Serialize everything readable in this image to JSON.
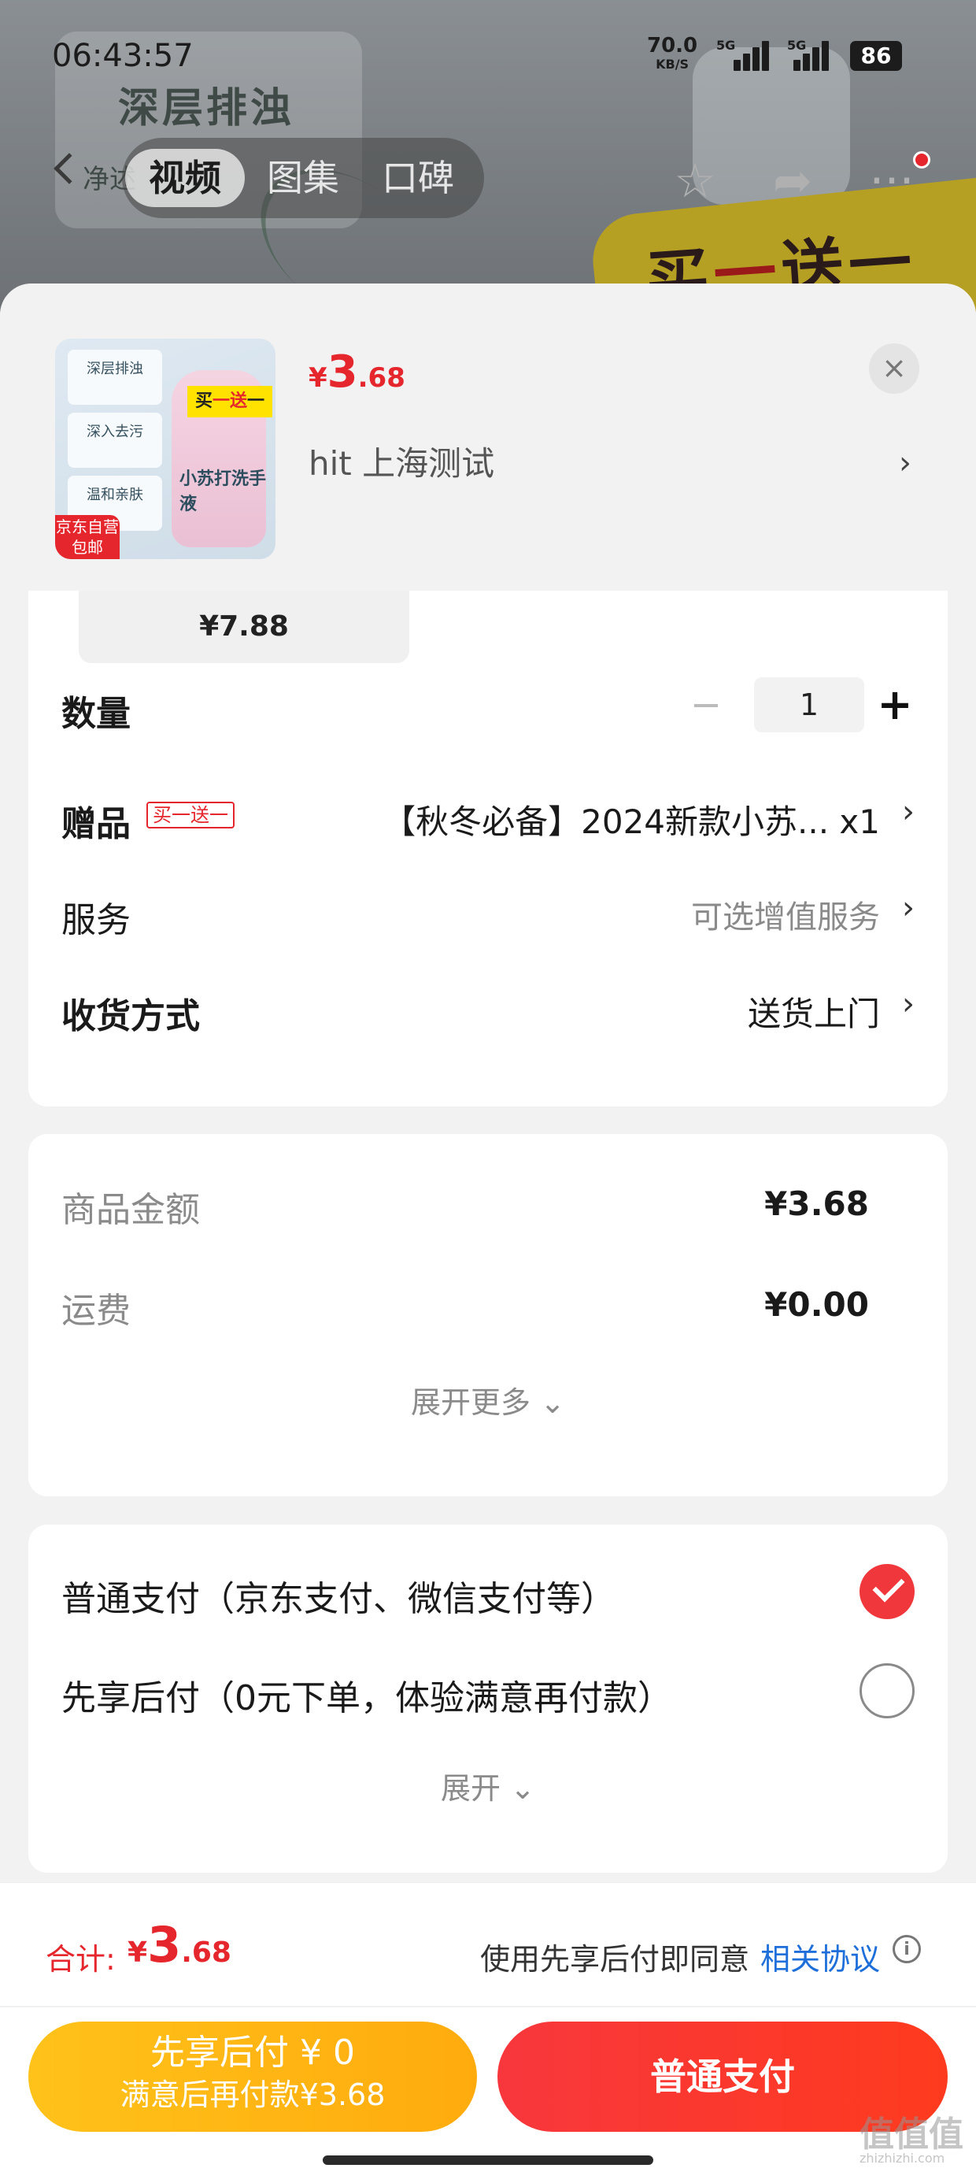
{
  "status_bar": {
    "time": "06:43:57",
    "net_speed": "70.0",
    "net_unit": "KB/S",
    "signal1_label": "5G",
    "signal2_label": "5G",
    "battery": "86"
  },
  "background_page": {
    "banner_title": "深层排浊",
    "banner_sub": "净述",
    "promo_text_a": "买",
    "promo_text_b": "一",
    "promo_text_c": "送一",
    "media_tabs": [
      "视频",
      "图集",
      "口碑"
    ],
    "active_tab_index": 0
  },
  "sheet": {
    "thumb": {
      "card1": "深层排浊",
      "card2": "深入去污",
      "card3": "温和亲肤",
      "promo_a": "买",
      "promo_b": "一送",
      "promo_c": "一",
      "bottle_label": "小苏打洗手液",
      "badge_line1": "京东自营",
      "badge_line2": "包邮"
    },
    "price": {
      "currency": "¥",
      "int": "3",
      "dec": ".68"
    },
    "variant": "hit  上海测试",
    "close_label": "×"
  },
  "card1": {
    "spec_price": "¥7.88",
    "quantity_label": "数量",
    "quantity_value": "1",
    "minus": "−",
    "plus": "+",
    "gift_label": "赠品",
    "gift_tag": "买一送一",
    "gift_value": "【秋冬必备】2024新款小苏... x1",
    "service_label": "服务",
    "service_value": "可选增值服务",
    "delivery_label": "收货方式",
    "delivery_value": "送货上门",
    "arrow": "›"
  },
  "card2": {
    "goods_amount_label": "商品金额",
    "goods_amount_value": "¥3.68",
    "shipping_label": "运费",
    "shipping_value": "¥0.00",
    "expand_more": "展开更多 ⌄"
  },
  "card3": {
    "pay_normal": "普通支付（京东支付、微信支付等）",
    "pay_normal_checked": true,
    "pay_bnpl": "先享后付（0元下单，体验满意再付款）",
    "pay_bnpl_checked": false,
    "expand": "展开 ⌄"
  },
  "bottom": {
    "total_label": "合计:",
    "total": {
      "currency": "¥",
      "int": "3",
      "dec": ".68"
    },
    "agree_text": "使用先享后付即同意",
    "agree_link": "相关协议",
    "info": "i",
    "bnpl_line1": "先享后付 ¥ 0",
    "bnpl_line2": "满意后再付款¥3.68",
    "pay_button": "普通支付",
    "watermark": "值值值",
    "watermark_sub": "zhizhizhi.com"
  },
  "colors": {
    "accent_red": "#e5262d",
    "pay_red": "#f8373d",
    "bnpl_yellow": "#ffb614",
    "link_blue": "#1e6fd9"
  }
}
